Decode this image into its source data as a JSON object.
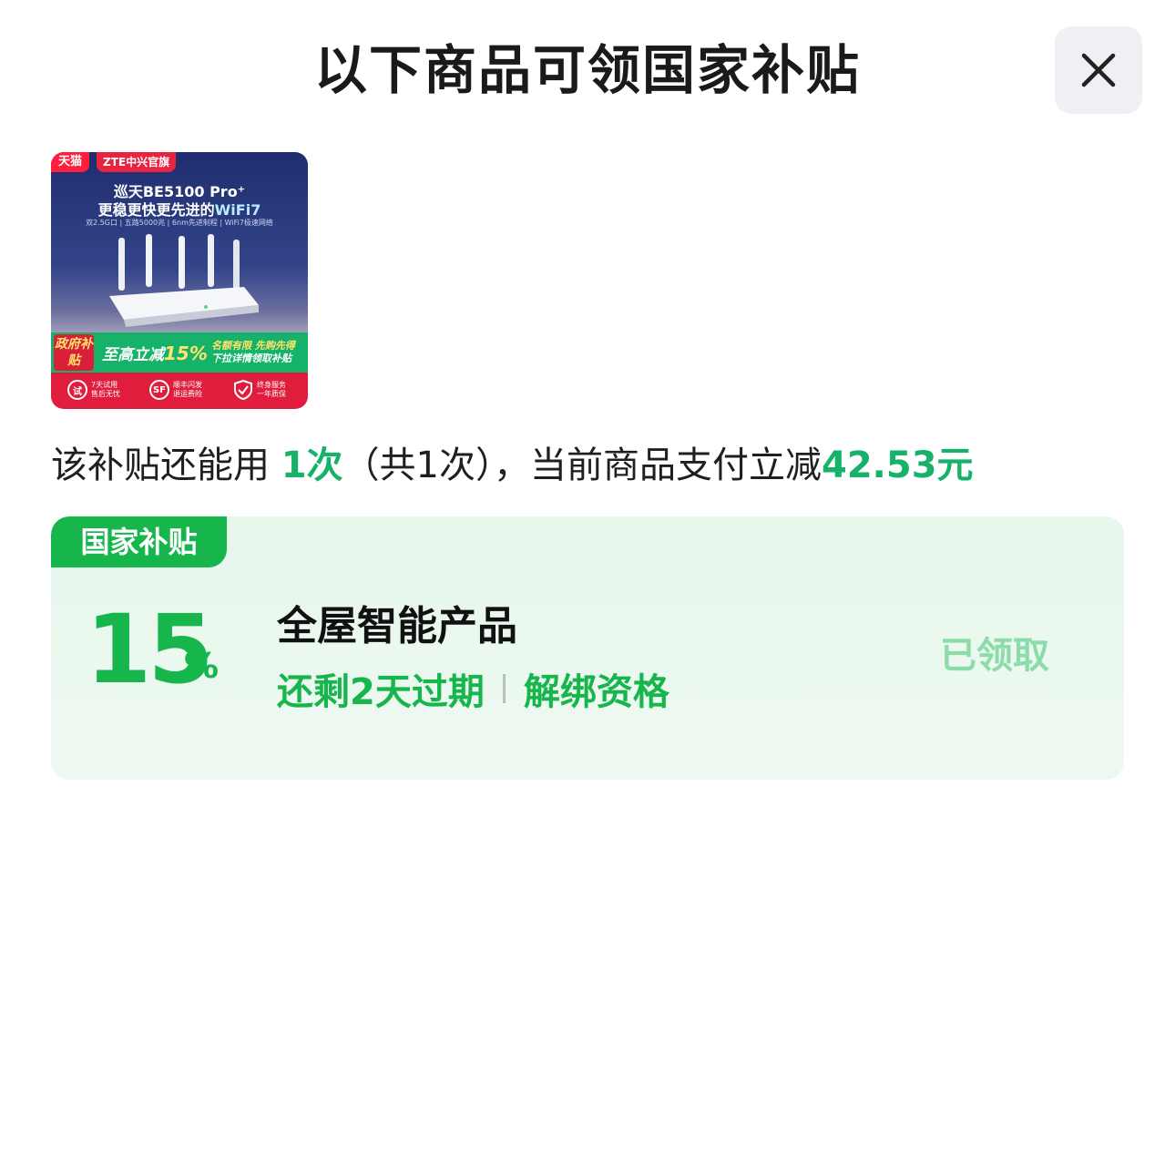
{
  "header": {
    "title": "以下商品可领国家补贴",
    "close_icon": "close-icon"
  },
  "product": {
    "badge_tmall": "天猫",
    "badge_store": "ZTE中兴官旗",
    "headline_1": "巡天BE5100 Pro⁺",
    "headline_2_a": "更稳更快更先进的",
    "headline_2_b": "WiFi7",
    "spec_line": "双2.5G口 | 五路5000兆 | 6nm先进制程 | WiFi7极速网络",
    "gov_label": "政府补贴",
    "band_main_prefix": "至高立减",
    "band_main_pct": "15%",
    "band_right_1": "名额有限 先购先得",
    "band_right_2": "下拉详情领取补贴",
    "service_1_icon": "试",
    "service_1_text_a": "7天试用",
    "service_1_text_b": "售后无忧",
    "service_2_icon": "SF",
    "service_2_text_a": "顺丰闪发",
    "service_2_text_b": "退运费险",
    "service_3_text_a": "终身服务",
    "service_3_text_b": "一年质保"
  },
  "info": {
    "prefix": "该补贴还能用 ",
    "times": "1次",
    "middle": "（共1次），当前商品支付立减",
    "amount": "42.53元"
  },
  "subsidy_card": {
    "tag": "国家补贴",
    "percent": "15",
    "percent_sign": "%",
    "title": "全屋智能产品",
    "expire": "还剩2天过期",
    "unbind": "解绑资格",
    "status": "已领取"
  },
  "colors": {
    "accent_green": "#17b64c",
    "claimed_green": "#8ddba8",
    "card_bg": "#e6f7ec"
  }
}
